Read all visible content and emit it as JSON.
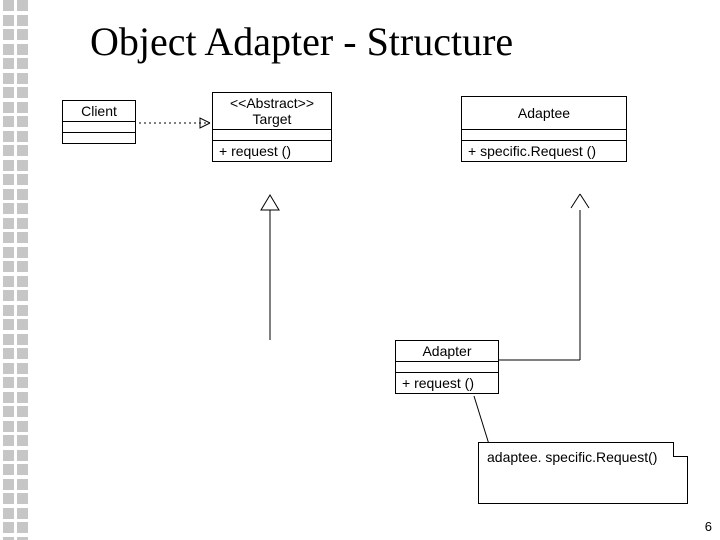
{
  "title": "Object Adapter - Structure",
  "page_number": "6",
  "classes": {
    "client": {
      "name": "Client"
    },
    "target": {
      "stereotype": "<<Abstract>>",
      "name": "Target",
      "method": "+ request ()"
    },
    "adaptee": {
      "name": "Adaptee",
      "method": "+ specific.Request ()"
    },
    "adapter": {
      "name": "Adapter",
      "method": "+ request ()"
    }
  },
  "note": {
    "text": "adaptee. specific.Request()"
  }
}
